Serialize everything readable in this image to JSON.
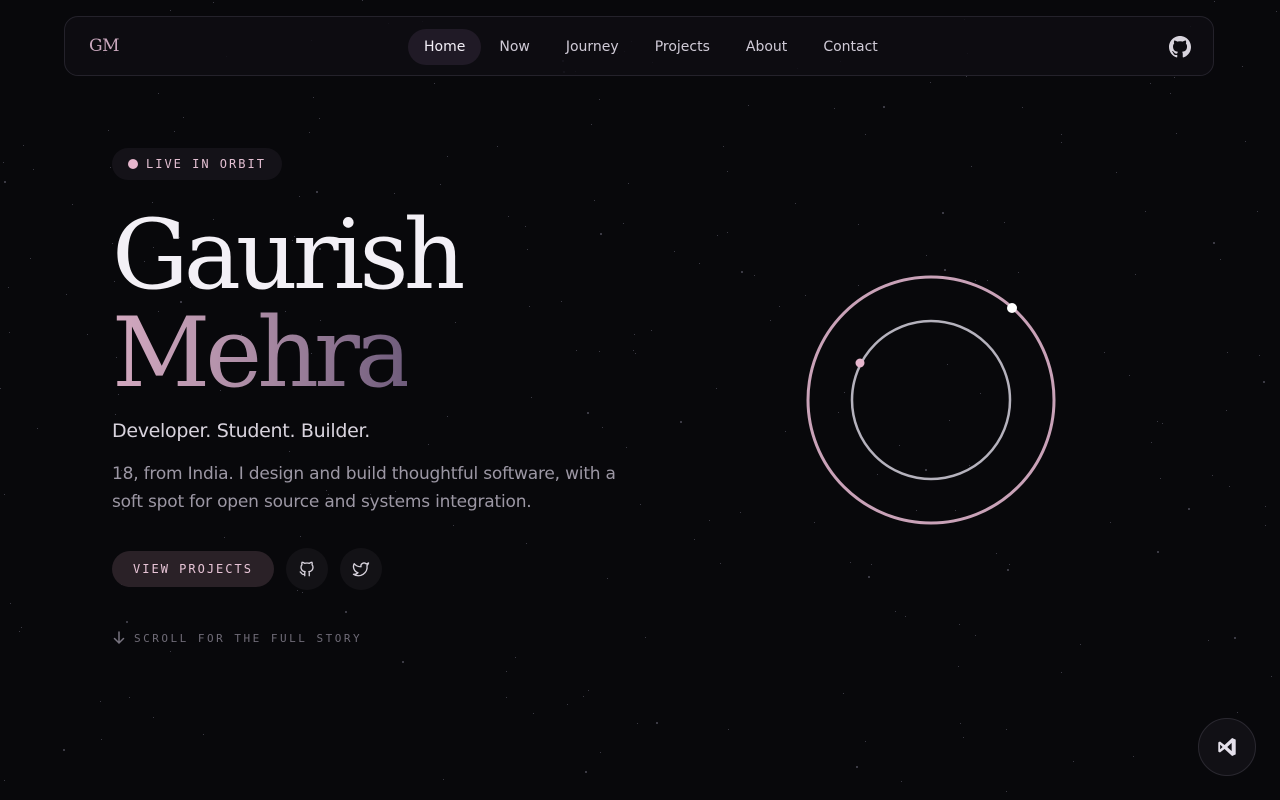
{
  "nav": {
    "logo": "GM",
    "links": [
      {
        "label": "Home",
        "active": true
      },
      {
        "label": "Now"
      },
      {
        "label": "Journey"
      },
      {
        "label": "Projects"
      },
      {
        "label": "About"
      },
      {
        "label": "Contact"
      }
    ],
    "github_icon": "github-icon"
  },
  "hero": {
    "badge": "LIVE IN ORBIT",
    "first_name": "Gaurish",
    "last_name": "Mehra",
    "tagline": "Developer. Student. Builder.",
    "bio": "18, from India. I design and build thoughtful software, with a soft spot for open source and systems integration.",
    "cta_label": "VIEW PROJECTS",
    "social_icons": [
      "github-icon",
      "twitter-icon"
    ],
    "scroll_hint": "SCROLL FOR THE FULL STORY"
  },
  "fab_icon": "vscode-icon",
  "colors": {
    "background": "#08080b",
    "accent_pink": "#e6b6cd",
    "orbit_outer": "#c9a2b8",
    "orbit_inner": "#b5b2bd"
  }
}
